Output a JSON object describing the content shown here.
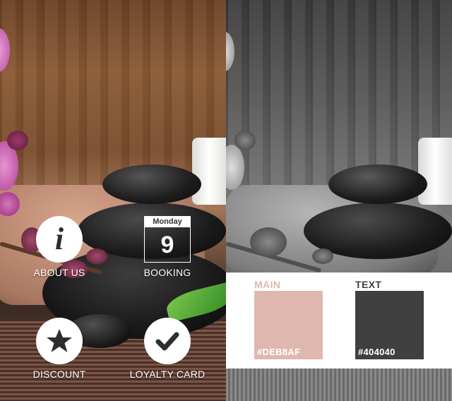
{
  "colors": {
    "main": "#DEB8AF",
    "text": "#404040"
  },
  "nav": {
    "about": {
      "label": "ABOUT US",
      "icon": "info-icon"
    },
    "booking": {
      "label": "BOOKING",
      "icon": "calendar-icon",
      "weekday": "Monday",
      "day": "9"
    },
    "discount": {
      "label": "DISCOUNT",
      "icon": "star-icon"
    },
    "loyalty": {
      "label": "LOYALTY CARD",
      "icon": "checkmark-icon"
    }
  },
  "palette": {
    "main": {
      "title": "MAIN",
      "code": "#DEB8AF"
    },
    "text": {
      "title": "TEXT",
      "code": "#404040"
    }
  }
}
